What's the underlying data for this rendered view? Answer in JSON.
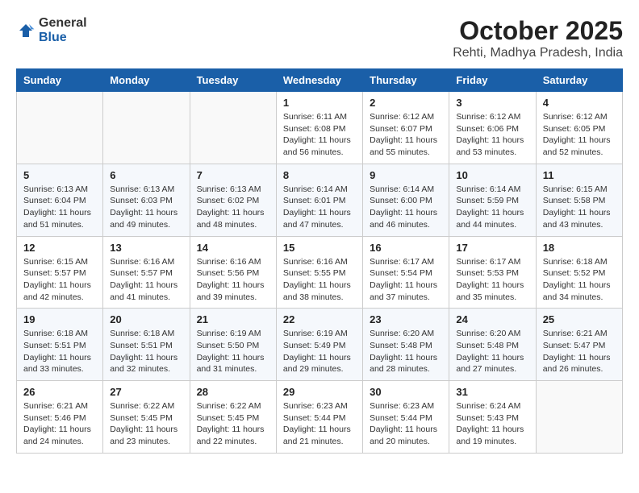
{
  "header": {
    "logo_general": "General",
    "logo_blue": "Blue",
    "month": "October 2025",
    "location": "Rehti, Madhya Pradesh, India"
  },
  "weekdays": [
    "Sunday",
    "Monday",
    "Tuesday",
    "Wednesday",
    "Thursday",
    "Friday",
    "Saturday"
  ],
  "weeks": [
    [
      {
        "day": "",
        "info": ""
      },
      {
        "day": "",
        "info": ""
      },
      {
        "day": "",
        "info": ""
      },
      {
        "day": "1",
        "info": "Sunrise: 6:11 AM\nSunset: 6:08 PM\nDaylight: 11 hours\nand 56 minutes."
      },
      {
        "day": "2",
        "info": "Sunrise: 6:12 AM\nSunset: 6:07 PM\nDaylight: 11 hours\nand 55 minutes."
      },
      {
        "day": "3",
        "info": "Sunrise: 6:12 AM\nSunset: 6:06 PM\nDaylight: 11 hours\nand 53 minutes."
      },
      {
        "day": "4",
        "info": "Sunrise: 6:12 AM\nSunset: 6:05 PM\nDaylight: 11 hours\nand 52 minutes."
      }
    ],
    [
      {
        "day": "5",
        "info": "Sunrise: 6:13 AM\nSunset: 6:04 PM\nDaylight: 11 hours\nand 51 minutes."
      },
      {
        "day": "6",
        "info": "Sunrise: 6:13 AM\nSunset: 6:03 PM\nDaylight: 11 hours\nand 49 minutes."
      },
      {
        "day": "7",
        "info": "Sunrise: 6:13 AM\nSunset: 6:02 PM\nDaylight: 11 hours\nand 48 minutes."
      },
      {
        "day": "8",
        "info": "Sunrise: 6:14 AM\nSunset: 6:01 PM\nDaylight: 11 hours\nand 47 minutes."
      },
      {
        "day": "9",
        "info": "Sunrise: 6:14 AM\nSunset: 6:00 PM\nDaylight: 11 hours\nand 46 minutes."
      },
      {
        "day": "10",
        "info": "Sunrise: 6:14 AM\nSunset: 5:59 PM\nDaylight: 11 hours\nand 44 minutes."
      },
      {
        "day": "11",
        "info": "Sunrise: 6:15 AM\nSunset: 5:58 PM\nDaylight: 11 hours\nand 43 minutes."
      }
    ],
    [
      {
        "day": "12",
        "info": "Sunrise: 6:15 AM\nSunset: 5:57 PM\nDaylight: 11 hours\nand 42 minutes."
      },
      {
        "day": "13",
        "info": "Sunrise: 6:16 AM\nSunset: 5:57 PM\nDaylight: 11 hours\nand 41 minutes."
      },
      {
        "day": "14",
        "info": "Sunrise: 6:16 AM\nSunset: 5:56 PM\nDaylight: 11 hours\nand 39 minutes."
      },
      {
        "day": "15",
        "info": "Sunrise: 6:16 AM\nSunset: 5:55 PM\nDaylight: 11 hours\nand 38 minutes."
      },
      {
        "day": "16",
        "info": "Sunrise: 6:17 AM\nSunset: 5:54 PM\nDaylight: 11 hours\nand 37 minutes."
      },
      {
        "day": "17",
        "info": "Sunrise: 6:17 AM\nSunset: 5:53 PM\nDaylight: 11 hours\nand 35 minutes."
      },
      {
        "day": "18",
        "info": "Sunrise: 6:18 AM\nSunset: 5:52 PM\nDaylight: 11 hours\nand 34 minutes."
      }
    ],
    [
      {
        "day": "19",
        "info": "Sunrise: 6:18 AM\nSunset: 5:51 PM\nDaylight: 11 hours\nand 33 minutes."
      },
      {
        "day": "20",
        "info": "Sunrise: 6:18 AM\nSunset: 5:51 PM\nDaylight: 11 hours\nand 32 minutes."
      },
      {
        "day": "21",
        "info": "Sunrise: 6:19 AM\nSunset: 5:50 PM\nDaylight: 11 hours\nand 31 minutes."
      },
      {
        "day": "22",
        "info": "Sunrise: 6:19 AM\nSunset: 5:49 PM\nDaylight: 11 hours\nand 29 minutes."
      },
      {
        "day": "23",
        "info": "Sunrise: 6:20 AM\nSunset: 5:48 PM\nDaylight: 11 hours\nand 28 minutes."
      },
      {
        "day": "24",
        "info": "Sunrise: 6:20 AM\nSunset: 5:48 PM\nDaylight: 11 hours\nand 27 minutes."
      },
      {
        "day": "25",
        "info": "Sunrise: 6:21 AM\nSunset: 5:47 PM\nDaylight: 11 hours\nand 26 minutes."
      }
    ],
    [
      {
        "day": "26",
        "info": "Sunrise: 6:21 AM\nSunset: 5:46 PM\nDaylight: 11 hours\nand 24 minutes."
      },
      {
        "day": "27",
        "info": "Sunrise: 6:22 AM\nSunset: 5:45 PM\nDaylight: 11 hours\nand 23 minutes."
      },
      {
        "day": "28",
        "info": "Sunrise: 6:22 AM\nSunset: 5:45 PM\nDaylight: 11 hours\nand 22 minutes."
      },
      {
        "day": "29",
        "info": "Sunrise: 6:23 AM\nSunset: 5:44 PM\nDaylight: 11 hours\nand 21 minutes."
      },
      {
        "day": "30",
        "info": "Sunrise: 6:23 AM\nSunset: 5:44 PM\nDaylight: 11 hours\nand 20 minutes."
      },
      {
        "day": "31",
        "info": "Sunrise: 6:24 AM\nSunset: 5:43 PM\nDaylight: 11 hours\nand 19 minutes."
      },
      {
        "day": "",
        "info": ""
      }
    ]
  ]
}
